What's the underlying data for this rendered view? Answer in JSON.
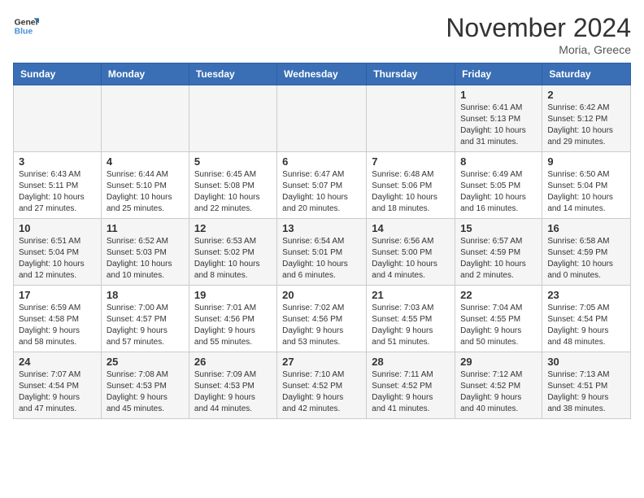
{
  "header": {
    "logo_line1": "General",
    "logo_line2": "Blue",
    "month": "November 2024",
    "location": "Moria, Greece"
  },
  "weekdays": [
    "Sunday",
    "Monday",
    "Tuesday",
    "Wednesday",
    "Thursday",
    "Friday",
    "Saturday"
  ],
  "weeks": [
    [
      {
        "day": "",
        "info": ""
      },
      {
        "day": "",
        "info": ""
      },
      {
        "day": "",
        "info": ""
      },
      {
        "day": "",
        "info": ""
      },
      {
        "day": "",
        "info": ""
      },
      {
        "day": "1",
        "info": "Sunrise: 6:41 AM\nSunset: 5:13 PM\nDaylight: 10 hours\nand 31 minutes."
      },
      {
        "day": "2",
        "info": "Sunrise: 6:42 AM\nSunset: 5:12 PM\nDaylight: 10 hours\nand 29 minutes."
      }
    ],
    [
      {
        "day": "3",
        "info": "Sunrise: 6:43 AM\nSunset: 5:11 PM\nDaylight: 10 hours\nand 27 minutes."
      },
      {
        "day": "4",
        "info": "Sunrise: 6:44 AM\nSunset: 5:10 PM\nDaylight: 10 hours\nand 25 minutes."
      },
      {
        "day": "5",
        "info": "Sunrise: 6:45 AM\nSunset: 5:08 PM\nDaylight: 10 hours\nand 22 minutes."
      },
      {
        "day": "6",
        "info": "Sunrise: 6:47 AM\nSunset: 5:07 PM\nDaylight: 10 hours\nand 20 minutes."
      },
      {
        "day": "7",
        "info": "Sunrise: 6:48 AM\nSunset: 5:06 PM\nDaylight: 10 hours\nand 18 minutes."
      },
      {
        "day": "8",
        "info": "Sunrise: 6:49 AM\nSunset: 5:05 PM\nDaylight: 10 hours\nand 16 minutes."
      },
      {
        "day": "9",
        "info": "Sunrise: 6:50 AM\nSunset: 5:04 PM\nDaylight: 10 hours\nand 14 minutes."
      }
    ],
    [
      {
        "day": "10",
        "info": "Sunrise: 6:51 AM\nSunset: 5:04 PM\nDaylight: 10 hours\nand 12 minutes."
      },
      {
        "day": "11",
        "info": "Sunrise: 6:52 AM\nSunset: 5:03 PM\nDaylight: 10 hours\nand 10 minutes."
      },
      {
        "day": "12",
        "info": "Sunrise: 6:53 AM\nSunset: 5:02 PM\nDaylight: 10 hours\nand 8 minutes."
      },
      {
        "day": "13",
        "info": "Sunrise: 6:54 AM\nSunset: 5:01 PM\nDaylight: 10 hours\nand 6 minutes."
      },
      {
        "day": "14",
        "info": "Sunrise: 6:56 AM\nSunset: 5:00 PM\nDaylight: 10 hours\nand 4 minutes."
      },
      {
        "day": "15",
        "info": "Sunrise: 6:57 AM\nSunset: 4:59 PM\nDaylight: 10 hours\nand 2 minutes."
      },
      {
        "day": "16",
        "info": "Sunrise: 6:58 AM\nSunset: 4:59 PM\nDaylight: 10 hours\nand 0 minutes."
      }
    ],
    [
      {
        "day": "17",
        "info": "Sunrise: 6:59 AM\nSunset: 4:58 PM\nDaylight: 9 hours\nand 58 minutes."
      },
      {
        "day": "18",
        "info": "Sunrise: 7:00 AM\nSunset: 4:57 PM\nDaylight: 9 hours\nand 57 minutes."
      },
      {
        "day": "19",
        "info": "Sunrise: 7:01 AM\nSunset: 4:56 PM\nDaylight: 9 hours\nand 55 minutes."
      },
      {
        "day": "20",
        "info": "Sunrise: 7:02 AM\nSunset: 4:56 PM\nDaylight: 9 hours\nand 53 minutes."
      },
      {
        "day": "21",
        "info": "Sunrise: 7:03 AM\nSunset: 4:55 PM\nDaylight: 9 hours\nand 51 minutes."
      },
      {
        "day": "22",
        "info": "Sunrise: 7:04 AM\nSunset: 4:55 PM\nDaylight: 9 hours\nand 50 minutes."
      },
      {
        "day": "23",
        "info": "Sunrise: 7:05 AM\nSunset: 4:54 PM\nDaylight: 9 hours\nand 48 minutes."
      }
    ],
    [
      {
        "day": "24",
        "info": "Sunrise: 7:07 AM\nSunset: 4:54 PM\nDaylight: 9 hours\nand 47 minutes."
      },
      {
        "day": "25",
        "info": "Sunrise: 7:08 AM\nSunset: 4:53 PM\nDaylight: 9 hours\nand 45 minutes."
      },
      {
        "day": "26",
        "info": "Sunrise: 7:09 AM\nSunset: 4:53 PM\nDaylight: 9 hours\nand 44 minutes."
      },
      {
        "day": "27",
        "info": "Sunrise: 7:10 AM\nSunset: 4:52 PM\nDaylight: 9 hours\nand 42 minutes."
      },
      {
        "day": "28",
        "info": "Sunrise: 7:11 AM\nSunset: 4:52 PM\nDaylight: 9 hours\nand 41 minutes."
      },
      {
        "day": "29",
        "info": "Sunrise: 7:12 AM\nSunset: 4:52 PM\nDaylight: 9 hours\nand 40 minutes."
      },
      {
        "day": "30",
        "info": "Sunrise: 7:13 AM\nSunset: 4:51 PM\nDaylight: 9 hours\nand 38 minutes."
      }
    ]
  ]
}
